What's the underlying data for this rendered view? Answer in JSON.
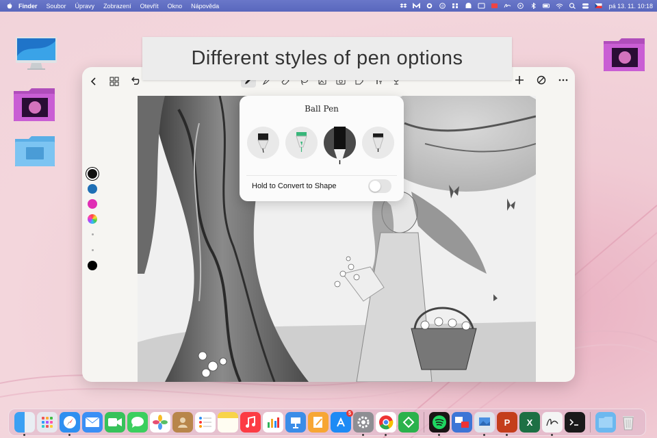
{
  "menubar": {
    "items": [
      "Finder",
      "Soubor",
      "Úpravy",
      "Zobrazení",
      "Otevřít",
      "Okno",
      "Nápověda"
    ],
    "clock": "pá 13. 11.  10:18"
  },
  "caption": "Different styles of pen options",
  "popup": {
    "title": "Ball Pen",
    "hold_label": "Hold to Convert to Shape",
    "hold_enabled": false,
    "selected_pen_index": 2
  },
  "palette": {
    "colors": [
      "#111111",
      "#1f6fb5",
      "#e02eb5"
    ],
    "selected_index": 0,
    "current_color": "#000000"
  },
  "dock": {
    "apps": [
      "finder-icon",
      "launchpad-icon",
      "safari-icon",
      "mail-icon",
      "facetime-icon",
      "messages-icon",
      "photos-icon",
      "contacts-icon",
      "reminders-icon",
      "notes-icon",
      "music-icon",
      "numbers-icon",
      "keynote-icon",
      "pages-icon",
      "app-store-icon",
      "system-settings-icon",
      "chrome-icon",
      "feedly-icon",
      "spotify-icon",
      "migration-icon",
      "preview-icon",
      "powerpoint-icon",
      "excel-icon",
      "signature-icon",
      "terminal-icon",
      "downloads-folder-icon",
      "trash-icon"
    ],
    "app_store_badge": "5"
  }
}
